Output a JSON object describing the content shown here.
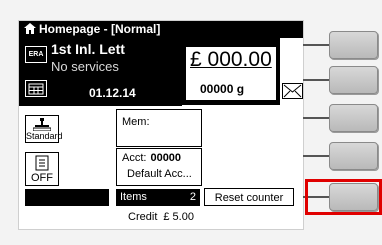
{
  "window": {
    "title": "Homepage - [Normal]"
  },
  "info": {
    "badge": "ERA",
    "carrier": "1st Inl. Lett",
    "service": "No services",
    "date": "01.12.14"
  },
  "meter": {
    "postage": "£ 000.00",
    "weight": "00000 g"
  },
  "left_buttons": {
    "standard_label": "Standard",
    "off_label": "OFF"
  },
  "memory": {
    "label": "Mem:"
  },
  "account": {
    "label": "Acct:",
    "number": "00000",
    "name": "Default Acc..."
  },
  "items": {
    "label": "Items",
    "count": "2"
  },
  "reset_button": {
    "label": "Reset counter"
  },
  "credit": {
    "label": "Credit",
    "amount": "£ 5.00"
  },
  "softkeys": {
    "count": 5,
    "highlighted_index": 4,
    "highlight_color": "#e00000"
  },
  "icons": {
    "title": "home-icon",
    "calendar": "calendar-icon",
    "mail": "envelope-icon",
    "scale": "scale-icon",
    "off": "off-icon"
  }
}
